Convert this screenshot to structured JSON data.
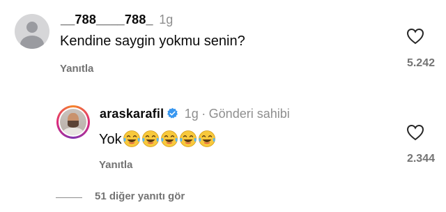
{
  "comment1": {
    "username": "__788____788_",
    "time": "1g",
    "text": "Kendine saygin yokmu senin?",
    "reply_label": "Yanıtla",
    "like_count": "5.242"
  },
  "comment2": {
    "username": "araskarafil",
    "time": "1g",
    "separator": "·",
    "author_label": "Gönderi sahibi",
    "text": "Yok",
    "emoji_count": 5,
    "reply_label": "Yanıtla",
    "like_count": "2.344"
  },
  "more_replies": "51 diğer yanıtı gör",
  "colors": {
    "verified": "#3897f0",
    "secondary_text": "#737373",
    "emoji_face": "#f8c93c"
  },
  "icons": [
    "avatar-placeholder",
    "heart-icon",
    "verified-badge-icon",
    "laughing-crying-emoji"
  ]
}
